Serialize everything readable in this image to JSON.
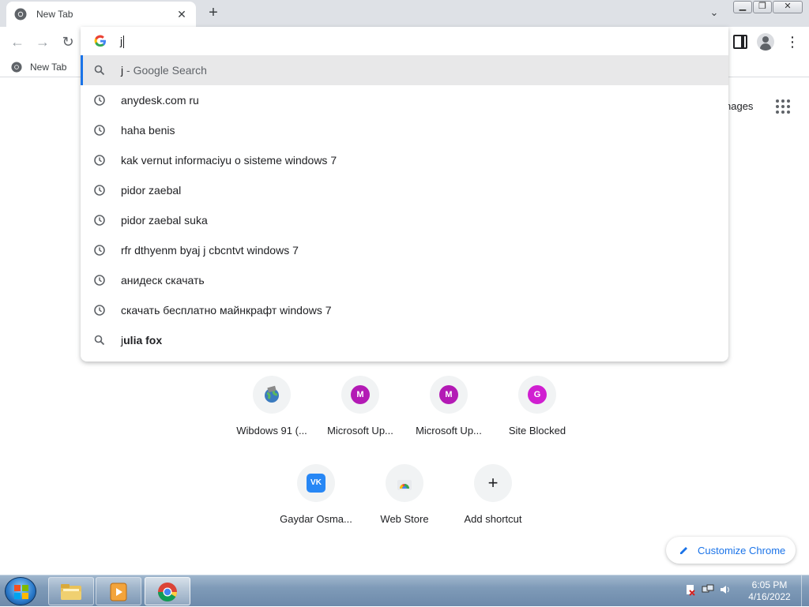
{
  "browser": {
    "tab": {
      "title": "New Tab",
      "close_glyph": "✕",
      "icon": "chrome-icon"
    },
    "new_tab_glyph": "+",
    "tab_search_glyph": "⌄",
    "window_controls": {
      "min": "▁",
      "max": "❐",
      "close": "✕"
    },
    "toolbar": {
      "back": "←",
      "forward": "→",
      "reload": "↻",
      "menu": "⋮"
    },
    "bookmarks": [
      {
        "label": "New Tab",
        "icon": "chrome-icon"
      }
    ]
  },
  "omnibox": {
    "value": "j",
    "suggestions": [
      {
        "text": "j",
        "suffix": " - Google Search",
        "icon": "search-icon",
        "selected": true
      },
      {
        "text": "anydesk.com ru",
        "icon": "history-icon"
      },
      {
        "text": "haha benis",
        "icon": "history-icon"
      },
      {
        "text": "kak vernut informaciyu o sisteme windows 7",
        "icon": "history-icon"
      },
      {
        "text": "pidor zaebal",
        "icon": "history-icon"
      },
      {
        "text": "pidor zaebal suka",
        "icon": "history-icon"
      },
      {
        "text": "rfr dthyenm byaj j cbcntvt windows 7",
        "icon": "history-icon"
      },
      {
        "text": "анидеск скачать",
        "icon": "history-icon"
      },
      {
        "text": "скачать бесплатно майнкрафт windows 7",
        "icon": "history-icon"
      },
      {
        "text_prefix": "j",
        "text_bold": "ulia fox",
        "icon": "search-icon"
      }
    ]
  },
  "ntp": {
    "images_link": "nages",
    "shortcuts": [
      {
        "label": "Wibdows 91 (...",
        "letter": "",
        "color": "#3b7bbf"
      },
      {
        "label": "Microsoft Up...",
        "letter": "M",
        "color": "#b31ab5"
      },
      {
        "label": "Microsoft Up...",
        "letter": "M",
        "color": "#b31ab5"
      },
      {
        "label": "Site Blocked",
        "letter": "G",
        "color": "#d01fd1"
      },
      {
        "label": "Gaydar Osma...",
        "letter": "VK",
        "color": "#2787f5"
      },
      {
        "label": "Web Store",
        "letter": "",
        "color": "#e8453c"
      },
      {
        "label": "Add shortcut",
        "letter": "+",
        "color": "#202124"
      }
    ],
    "customize_label": "Customize Chrome"
  },
  "taskbar": {
    "apps": [
      "explorer-icon",
      "media-player-icon",
      "chrome-icon"
    ],
    "clock_time": "6:05 PM",
    "clock_date": "4/16/2022"
  },
  "colors": {
    "accent": "#1a73e8",
    "selection": "#e8e8e9",
    "tabstrip": "#dee1e6"
  }
}
